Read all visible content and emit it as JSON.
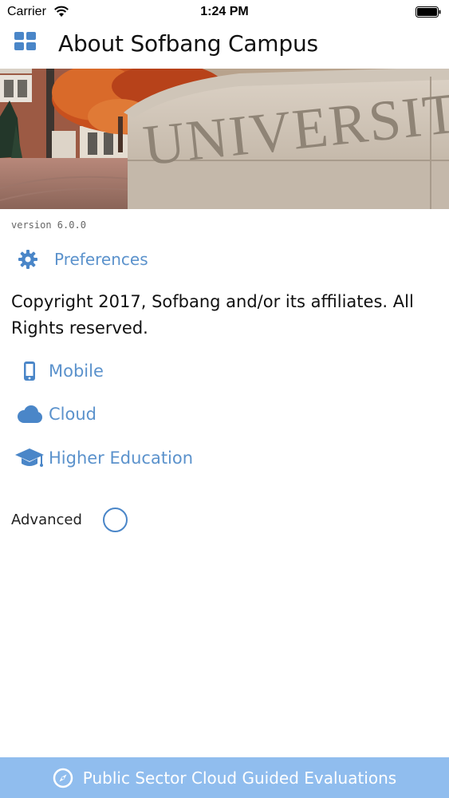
{
  "status_bar": {
    "carrier": "Carrier",
    "time": "1:24 PM"
  },
  "header": {
    "title": "About Sofbang Campus",
    "menu_icon": "grid-icon"
  },
  "banner": {
    "engraved_text": "UNIVERSITY"
  },
  "version": "version 6.0.0",
  "preferences": {
    "label": "Preferences",
    "icon": "gear-icon"
  },
  "copyright": "Copyright 2017, Sofbang and/or its affiliates. All Rights reserved.",
  "links": [
    {
      "label": "Mobile",
      "icon": "mobile-icon"
    },
    {
      "label": "Cloud",
      "icon": "cloud-icon"
    },
    {
      "label": "Higher Education",
      "icon": "graduation-cap-icon"
    }
  ],
  "advanced": {
    "label": "Advanced",
    "checked": false
  },
  "footer": {
    "label": "Public Sector Cloud Guided Evaluations",
    "icon": "compass-icon"
  },
  "colors": {
    "accent": "#4a86c8",
    "link": "#5b92cc",
    "footer_bg": "#90bdee"
  }
}
